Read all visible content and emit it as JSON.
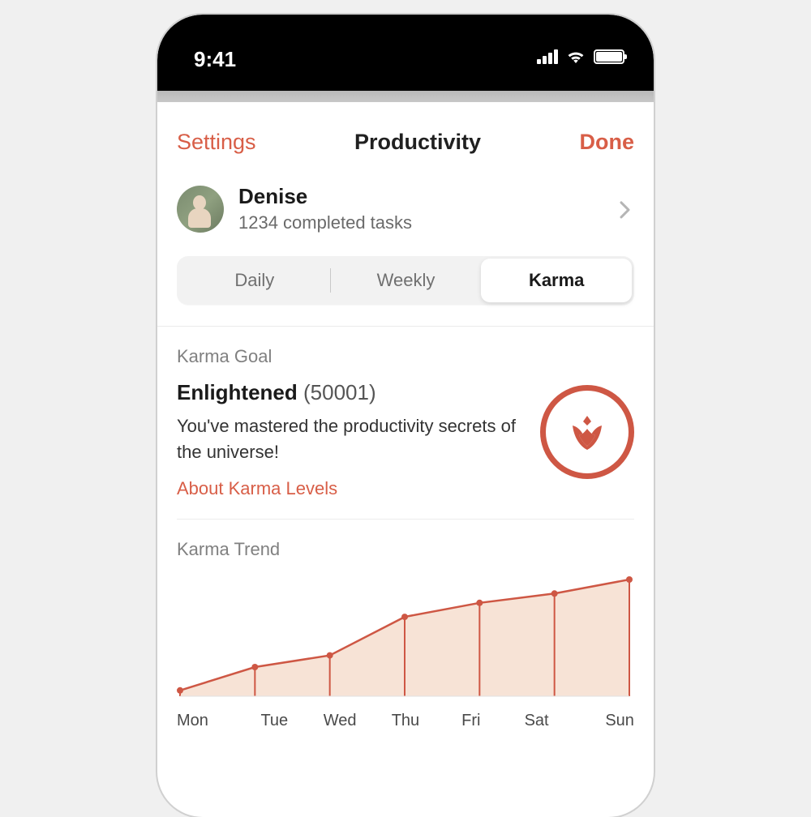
{
  "status": {
    "time": "9:41"
  },
  "nav": {
    "back": "Settings",
    "title": "Productivity",
    "done": "Done"
  },
  "profile": {
    "name": "Denise",
    "subtitle": "1234 completed tasks"
  },
  "tabs": {
    "items": [
      "Daily",
      "Weekly",
      "Karma"
    ],
    "selected": 2
  },
  "karma_goal": {
    "section_label": "Karma Goal",
    "level": "Enlightened",
    "points": "(50001)",
    "description": "You've mastered the productivity secrets of the universe!",
    "link": "About Karma Levels"
  },
  "trend": {
    "section_label": "Karma Trend"
  },
  "chart_data": {
    "type": "area",
    "categories": [
      "Mon",
      "Tue",
      "Wed",
      "Thu",
      "Fri",
      "Sat",
      "Sun"
    ],
    "values": [
      5,
      25,
      35,
      68,
      80,
      88,
      100
    ],
    "ylim": [
      0,
      100
    ],
    "xlabel": "",
    "ylabel": "",
    "title": "Karma Trend"
  },
  "colors": {
    "accent": "#d85e47",
    "accent_dark": "#ce5744"
  }
}
